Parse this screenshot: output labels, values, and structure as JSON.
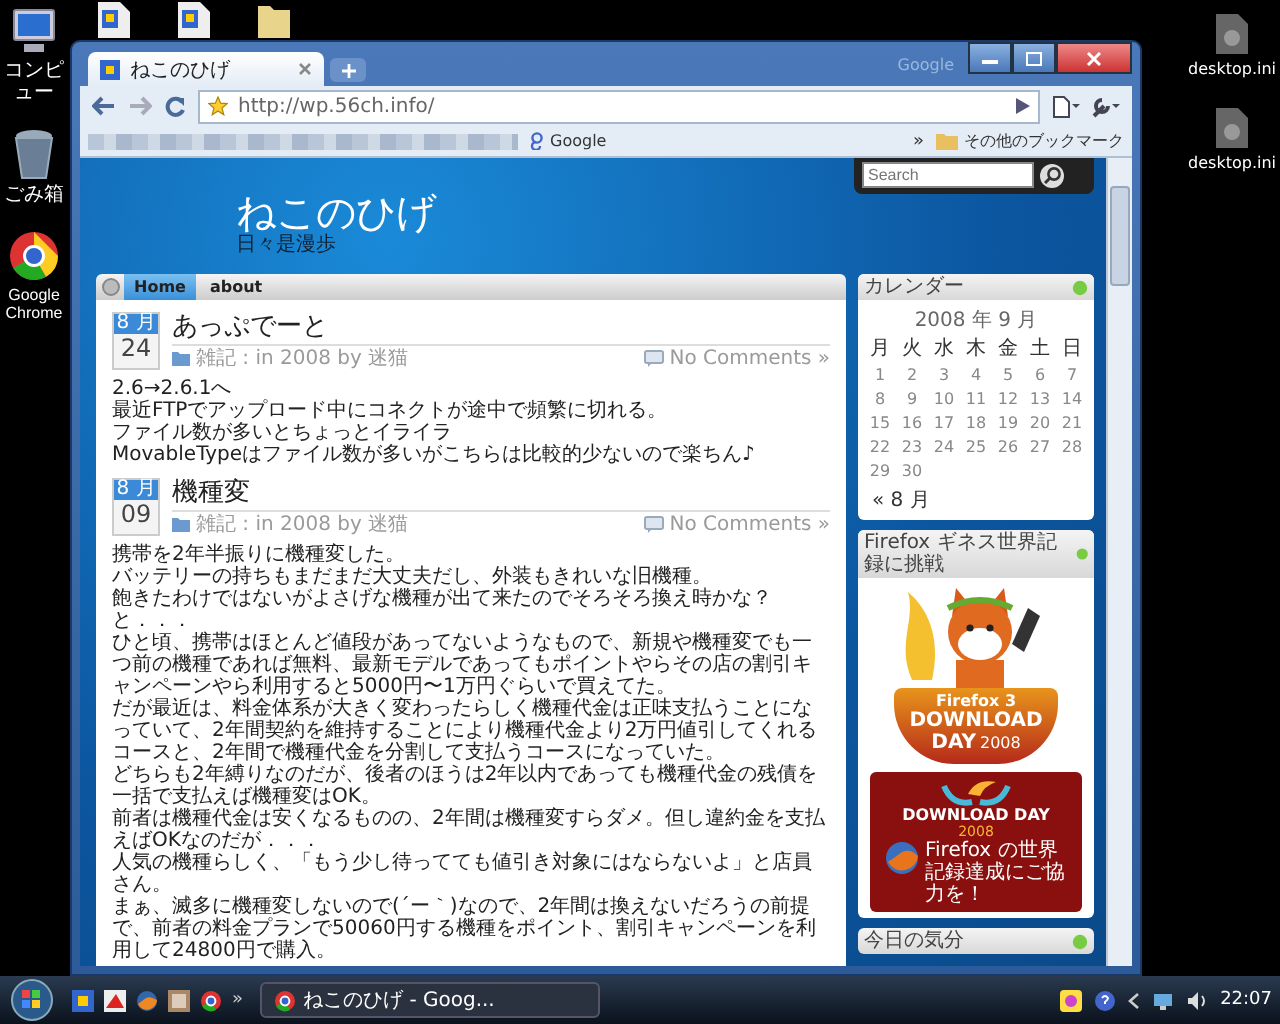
{
  "desktop_icons": [
    {
      "kind": "computer",
      "label": "コンピュー"
    },
    {
      "kind": "trash",
      "label": "ごみ箱"
    },
    {
      "kind": "chrome",
      "label": "Google Chrome"
    }
  ],
  "right_icons": [
    {
      "label": "desktop.ini"
    },
    {
      "label": "desktop.ini"
    }
  ],
  "browser": {
    "title_logo": "Google",
    "tab": {
      "title": "ねこのひげ"
    },
    "url": "http://wp.56ch.info/",
    "bookmarks": [
      {
        "label": "Google"
      }
    ],
    "more": "»",
    "other_bookmarks": "その他のブックマーク"
  },
  "page": {
    "site_title": "ねこのひげ",
    "tagline": "日々是漫歩",
    "search": {
      "placeholder": "Search"
    },
    "nav": [
      {
        "label": "Home",
        "selected": true
      },
      {
        "label": "about",
        "selected": false
      }
    ],
    "posts": [
      {
        "month": "8 月",
        "day": "24",
        "title": "あっぷでーと",
        "meta": "雑記 : in 2008 by 迷猫",
        "comments": "No Comments »",
        "body": [
          "2.6→2.6.1へ",
          "最近FTPでアップロード中にコネクトが途中で頻繁に切れる。",
          "ファイル数が多いとちょっとイライラ",
          "MovableTypeはファイル数が多いがこちらは比較的少ないので楽ちん♪"
        ]
      },
      {
        "month": "8 月",
        "day": "09",
        "title": "機種変",
        "meta": "雑記 : in 2008 by 迷猫",
        "comments": "No Comments »",
        "body": [
          "携帯を2年半振りに機種変した。",
          "バッテリーの持ちもまだまだ大丈夫だし、外装もきれいな旧機種。",
          "飽きたわけではないがよさげな機種が出て来たのでそろそろ換え時かな？と．．．",
          "ひと頃、携帯はほとんど値段があってないようなもので、新規や機種変でも一つ前の機種であれば無料、最新モデルであってもポイントやらその店の割引キャンペーンやら利用すると5000円〜1万円ぐらいで買えてた。",
          "だが最近は、料金体系が大きく変わったらしく機種代金は正味支払うことになっていて、2年間契約を維持することにより機種代金より2万円値引してくれるコースと、2年間で機種代金を分割して支払うコースになっていた。",
          "どちらも2年縛りなのだが、後者のほうは2年以内であっても機種代金の残債を一括で支払えば機種変はOK。",
          "前者は機種代金は安くなるものの、2年間は機種変すらダメ。但し違約金を支払えばOKなのだが．．．",
          "人気の機種らしく、「もう少し待ってても値引き対象にはならないよ」と店員さん。",
          "まぁ、滅多に機種変しないので(´ー｀)なので、2年間は換えないだろうの前提で、前者の料金プランで50060円する機種をポイント、割引キャンペーンを利用して24800円で購入。"
        ]
      }
    ],
    "widgets": [
      {
        "kind": "calendar",
        "title": "カレンダー",
        "caption": "2008 年 9 月",
        "weekdays": [
          "月",
          "火",
          "水",
          "木",
          "金",
          "土",
          "日"
        ],
        "weeks": [
          [
            "1",
            "2",
            "3",
            "4",
            "5",
            "6",
            "7"
          ],
          [
            "8",
            "9",
            "10",
            "11",
            "12",
            "13",
            "14"
          ],
          [
            "15",
            "16",
            "17",
            "18",
            "19",
            "20",
            "21"
          ],
          [
            "22",
            "23",
            "24",
            "25",
            "26",
            "27",
            "28"
          ],
          [
            "29",
            "30"
          ]
        ],
        "prev": "« 8 月"
      },
      {
        "kind": "banner",
        "title": "Firefox ギネス世界記録に挑戦",
        "badge_top": "Firefox 3",
        "badge_main": "DOWNLOAD",
        "badge_sub": "DAY",
        "badge_year": "2008",
        "promo_title": "DOWNLOAD DAY",
        "promo_year": "2008",
        "promo_text": "Firefox の世界記録達成にご協力を！"
      },
      {
        "kind": "plain",
        "title": "今日の気分"
      }
    ]
  },
  "taskbar": {
    "quick_launch_more": "»",
    "task": {
      "label": "ねこのひげ - Goog..."
    },
    "clock": "22:07"
  }
}
